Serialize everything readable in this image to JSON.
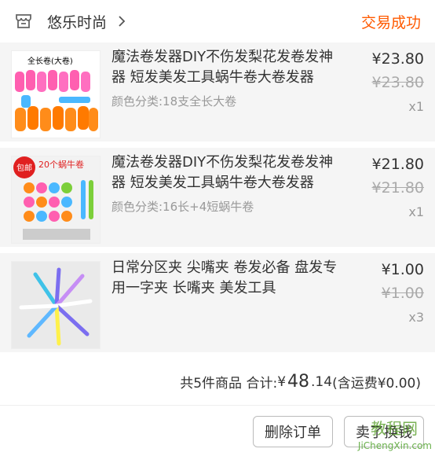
{
  "order": {
    "shop_name": "悠乐时尚",
    "status": "交易成功",
    "status_color": "#ff5a00",
    "items": [
      {
        "title": "魔法卷发器DIY不伤发梨花发卷发神器 短发美发工具蜗牛卷大卷发器",
        "spec": "颜色分类:18支全长大卷",
        "price": "¥23.80",
        "old_price": "¥23.80",
        "qty": "x1",
        "thumb_label": "全长卷(大卷)"
      },
      {
        "title": "魔法卷发器DIY不伤发梨花发卷发神器 短发美发工具蜗牛卷大卷发器",
        "spec": "颜色分类:16长+4短蜗牛卷",
        "price": "¥21.80",
        "old_price": "¥21.80",
        "qty": "x1",
        "thumb_label": "20个蜗牛卷",
        "thumb_badge": "包邮"
      },
      {
        "title": "日常分区夹 尖嘴夹 卷发必备 盘发专用一字夹 长嘴夹 美发工具",
        "spec": "",
        "price": "¥1.00",
        "old_price": "¥1.00",
        "qty": "x3"
      }
    ],
    "summary": {
      "count_text": "共5件商品 合计:",
      "currency": "¥",
      "total_int": "48",
      "total_dec": ".14",
      "shipping_text": "(含运费¥0.00)"
    },
    "actions": {
      "delete_label": "删除订单",
      "exchange_label": "卖了换钱"
    }
  },
  "watermark": {
    "logo": "教程网",
    "url": "JiChengXin.com"
  }
}
